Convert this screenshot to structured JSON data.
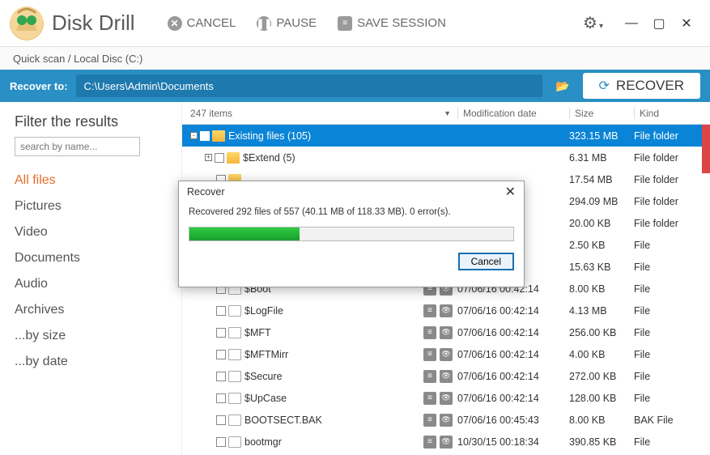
{
  "app": {
    "title": "Disk Drill"
  },
  "toolbar": {
    "cancel": "CANCEL",
    "pause": "PAUSE",
    "save_session": "SAVE SESSION"
  },
  "breadcrumb": "Quick scan / Local Disc (C:)",
  "recover_bar": {
    "label": "Recover to:",
    "path": "C:\\Users\\Admin\\Documents",
    "button": "RECOVER"
  },
  "sidebar": {
    "title": "Filter the results",
    "search_placeholder": "search by name...",
    "items": [
      "All files",
      "Pictures",
      "Video",
      "Documents",
      "Audio",
      "Archives",
      "...by size",
      "...by date"
    ]
  },
  "columns": {
    "items_count": "247 items",
    "mod": "Modification date",
    "size": "Size",
    "kind": "Kind"
  },
  "rows": [
    {
      "indent": 0,
      "exp": "-",
      "folder": true,
      "name": "Existing files (105)",
      "mod": "",
      "size": "323.15 MB",
      "kind": "File folder",
      "sel": true,
      "acts": false
    },
    {
      "indent": 1,
      "exp": "+",
      "folder": true,
      "name": "$Extend (5)",
      "mod": "",
      "size": "6.31 MB",
      "kind": "File folder",
      "acts": false
    },
    {
      "indent": 1,
      "folder": true,
      "name": "",
      "mod": "",
      "size": "17.54 MB",
      "kind": "File folder",
      "acts": false,
      "hidden_by_dialog": true
    },
    {
      "indent": 1,
      "folder": true,
      "name": "",
      "mod": "",
      "size": "294.09 MB",
      "kind": "File folder",
      "acts": false,
      "hidden_by_dialog": true
    },
    {
      "indent": 1,
      "folder": true,
      "name": "",
      "mod": "",
      "size": "20.00 KB",
      "kind": "File folder",
      "acts": false,
      "hidden_by_dialog": true
    },
    {
      "indent": 1,
      "folder": false,
      "name": "",
      "mod": ":14",
      "size": "2.50 KB",
      "kind": "File",
      "acts": false,
      "hidden_by_dialog": true
    },
    {
      "indent": 1,
      "folder": false,
      "name": "",
      "mod": ":14",
      "size": "15.63 KB",
      "kind": "File",
      "acts": false,
      "hidden_by_dialog": true
    },
    {
      "indent": 1,
      "folder": false,
      "name": "$Boot",
      "mod": "07/06/16 00:42:14",
      "size": "8.00 KB",
      "kind": "File",
      "acts": true
    },
    {
      "indent": 1,
      "folder": false,
      "name": "$LogFile",
      "mod": "07/06/16 00:42:14",
      "size": "4.13 MB",
      "kind": "File",
      "acts": true
    },
    {
      "indent": 1,
      "folder": false,
      "name": "$MFT",
      "mod": "07/06/16 00:42:14",
      "size": "256.00 KB",
      "kind": "File",
      "acts": true
    },
    {
      "indent": 1,
      "folder": false,
      "name": "$MFTMirr",
      "mod": "07/06/16 00:42:14",
      "size": "4.00 KB",
      "kind": "File",
      "acts": true
    },
    {
      "indent": 1,
      "folder": false,
      "name": "$Secure",
      "mod": "07/06/16 00:42:14",
      "size": "272.00 KB",
      "kind": "File",
      "acts": true
    },
    {
      "indent": 1,
      "folder": false,
      "name": "$UpCase",
      "mod": "07/06/16 00:42:14",
      "size": "128.00 KB",
      "kind": "File",
      "acts": true
    },
    {
      "indent": 1,
      "folder": false,
      "name": "BOOTSECT.BAK",
      "mod": "07/06/16 00:45:43",
      "size": "8.00 KB",
      "kind": "BAK File",
      "acts": true
    },
    {
      "indent": 1,
      "folder": false,
      "name": "bootmgr",
      "mod": "10/30/15 00:18:34",
      "size": "390.85 KB",
      "kind": "File",
      "acts": true
    }
  ],
  "dialog": {
    "title": "Recover",
    "message": "Recovered 292 files of 557 (40.11 MB of 118.33 MB). 0 error(s).",
    "progress_pct": 34,
    "cancel": "Cancel"
  }
}
